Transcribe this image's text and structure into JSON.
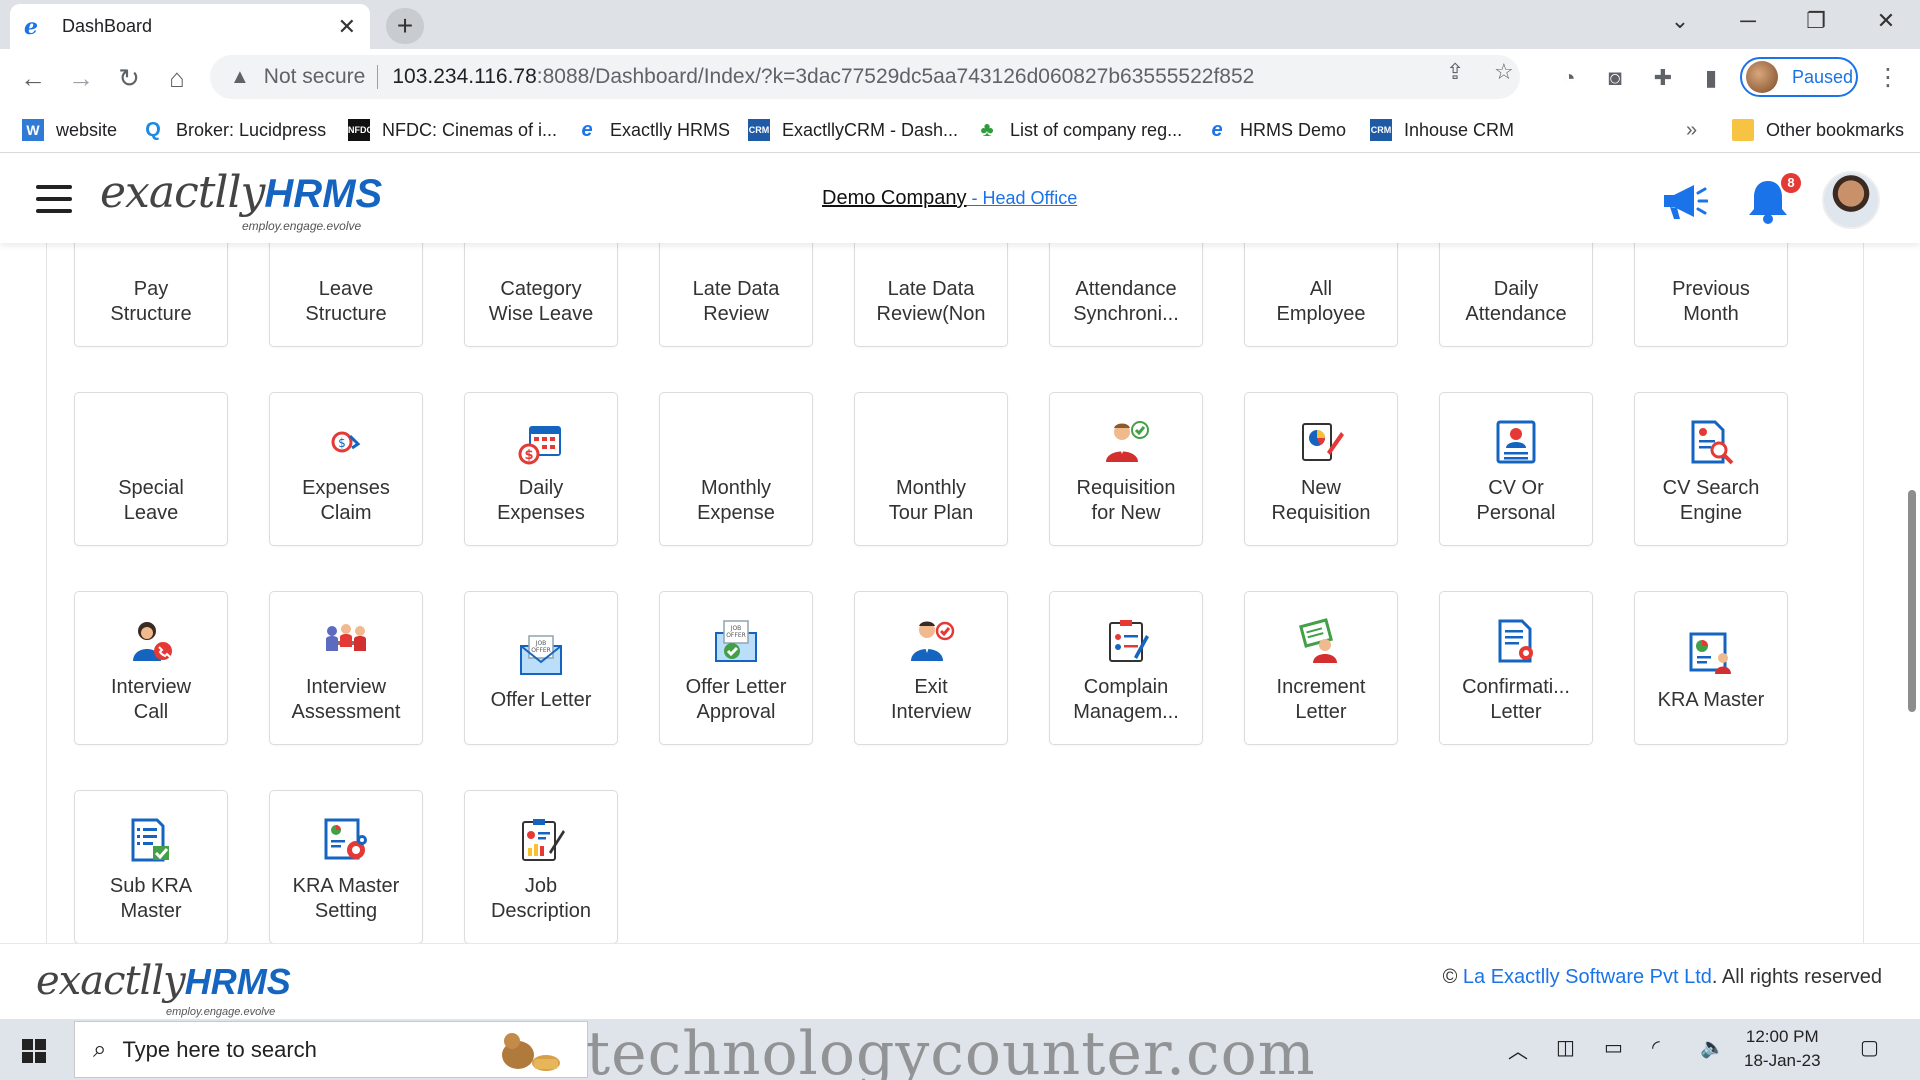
{
  "browser": {
    "tab_title": "DashBoard",
    "tab_close": "✕",
    "new_tab": "+",
    "security_label": "Not secure",
    "url_host": "103.234.116.78",
    "url_path": ":8088/Dashboard/Index/?k=3dac77529dc5aa743126d060827b63555522f852",
    "profile_label": "Paused",
    "bookmarks": [
      {
        "label": "website",
        "icon": "w-icon"
      },
      {
        "label": "Broker: Lucidpress",
        "icon": "lucidpress-icon"
      },
      {
        "label": "NFDC: Cinemas of i...",
        "icon": "nfdc-icon"
      },
      {
        "label": "Exactlly HRMS",
        "icon": "e-icon"
      },
      {
        "label": "ExactllyCRM - Dash...",
        "icon": "crm-icon"
      },
      {
        "label": "List of company reg...",
        "icon": "plant-icon"
      },
      {
        "label": "HRMS Demo",
        "icon": "e-icon"
      },
      {
        "label": "Inhouse CRM",
        "icon": "crm-icon"
      }
    ],
    "bookmarks_more": "»",
    "other_bookmarks": "Other bookmarks"
  },
  "header": {
    "logo_part1": "exactlly",
    "logo_part2": "HRMS",
    "logo_tagline": "employ.engage.evolve",
    "company_name": "Demo Company",
    "office_label": " - Head Office",
    "notification_count": "8"
  },
  "tiles": [
    {
      "label": "Pay\nStructure",
      "icon": "blank"
    },
    {
      "label": "Leave\nStructure",
      "icon": "blank"
    },
    {
      "label": "Category\nWise Leave",
      "icon": "blank"
    },
    {
      "label": "Late Data\nReview",
      "icon": "blank"
    },
    {
      "label": "Late Data\nReview(Non",
      "icon": "blank"
    },
    {
      "label": "Attendance\nSynchroni...",
      "icon": "blank"
    },
    {
      "label": "All\nEmployee",
      "icon": "blank"
    },
    {
      "label": "Daily\nAttendance",
      "icon": "blank"
    },
    {
      "label": "Previous\nMonth",
      "icon": "blank"
    },
    {
      "label": "Special\nLeave",
      "icon": "blank"
    },
    {
      "label": "Expenses\nClaim",
      "icon": "expense-claim-icon"
    },
    {
      "label": "Daily\nExpenses",
      "icon": "calendar-money-icon"
    },
    {
      "label": "Monthly\nExpense",
      "icon": "blank"
    },
    {
      "label": "Monthly\nTour Plan",
      "icon": "blank"
    },
    {
      "label": "Requisition\nfor New",
      "icon": "person-check-icon"
    },
    {
      "label": "New\nRequisition",
      "icon": "document-pen-icon"
    },
    {
      "label": "CV Or\nPersonal",
      "icon": "cv-card-icon"
    },
    {
      "label": "CV Search\nEngine",
      "icon": "document-search-icon"
    },
    {
      "label": "Interview\nCall",
      "icon": "person-phone-icon"
    },
    {
      "label": "Interview\nAssessment",
      "icon": "meeting-icon"
    },
    {
      "label": "Offer Letter",
      "icon": "envelope-icon"
    },
    {
      "label": "Offer Letter\nApproval",
      "icon": "envelope-check-icon"
    },
    {
      "label": "Exit\nInterview",
      "icon": "person-cancel-icon"
    },
    {
      "label": "Complain\nManagem...",
      "icon": "clipboard-people-icon"
    },
    {
      "label": "Increment\nLetter",
      "icon": "person-letter-icon"
    },
    {
      "label": "Confirmati...\nLetter",
      "icon": "certificate-icon"
    },
    {
      "label": "KRA Master",
      "icon": "chart-person-icon"
    },
    {
      "label": "Sub KRA\nMaster",
      "icon": "checklist-icon"
    },
    {
      "label": "KRA Master\nSetting",
      "icon": "chart-gear-icon"
    },
    {
      "label": "Job\nDescription",
      "icon": "clipboard-chart-icon"
    }
  ],
  "footer": {
    "logo_part1": "exactlly",
    "logo_part2": "HRMS",
    "logo_tagline": "employ.engage.evolve",
    "copyright_symbol": "© ",
    "company_link": "La Exactlly Software Pvt Ltd",
    "rights": ". All rights reserved"
  },
  "taskbar": {
    "search_placeholder": "Type here to search",
    "watermark": "technologycounter.com",
    "time": "12:00 PM",
    "date": "18-Jan-23"
  },
  "colors": {
    "brand_blue": "#1565c0",
    "link_blue": "#1a73e8",
    "badge_red": "#e53935"
  }
}
